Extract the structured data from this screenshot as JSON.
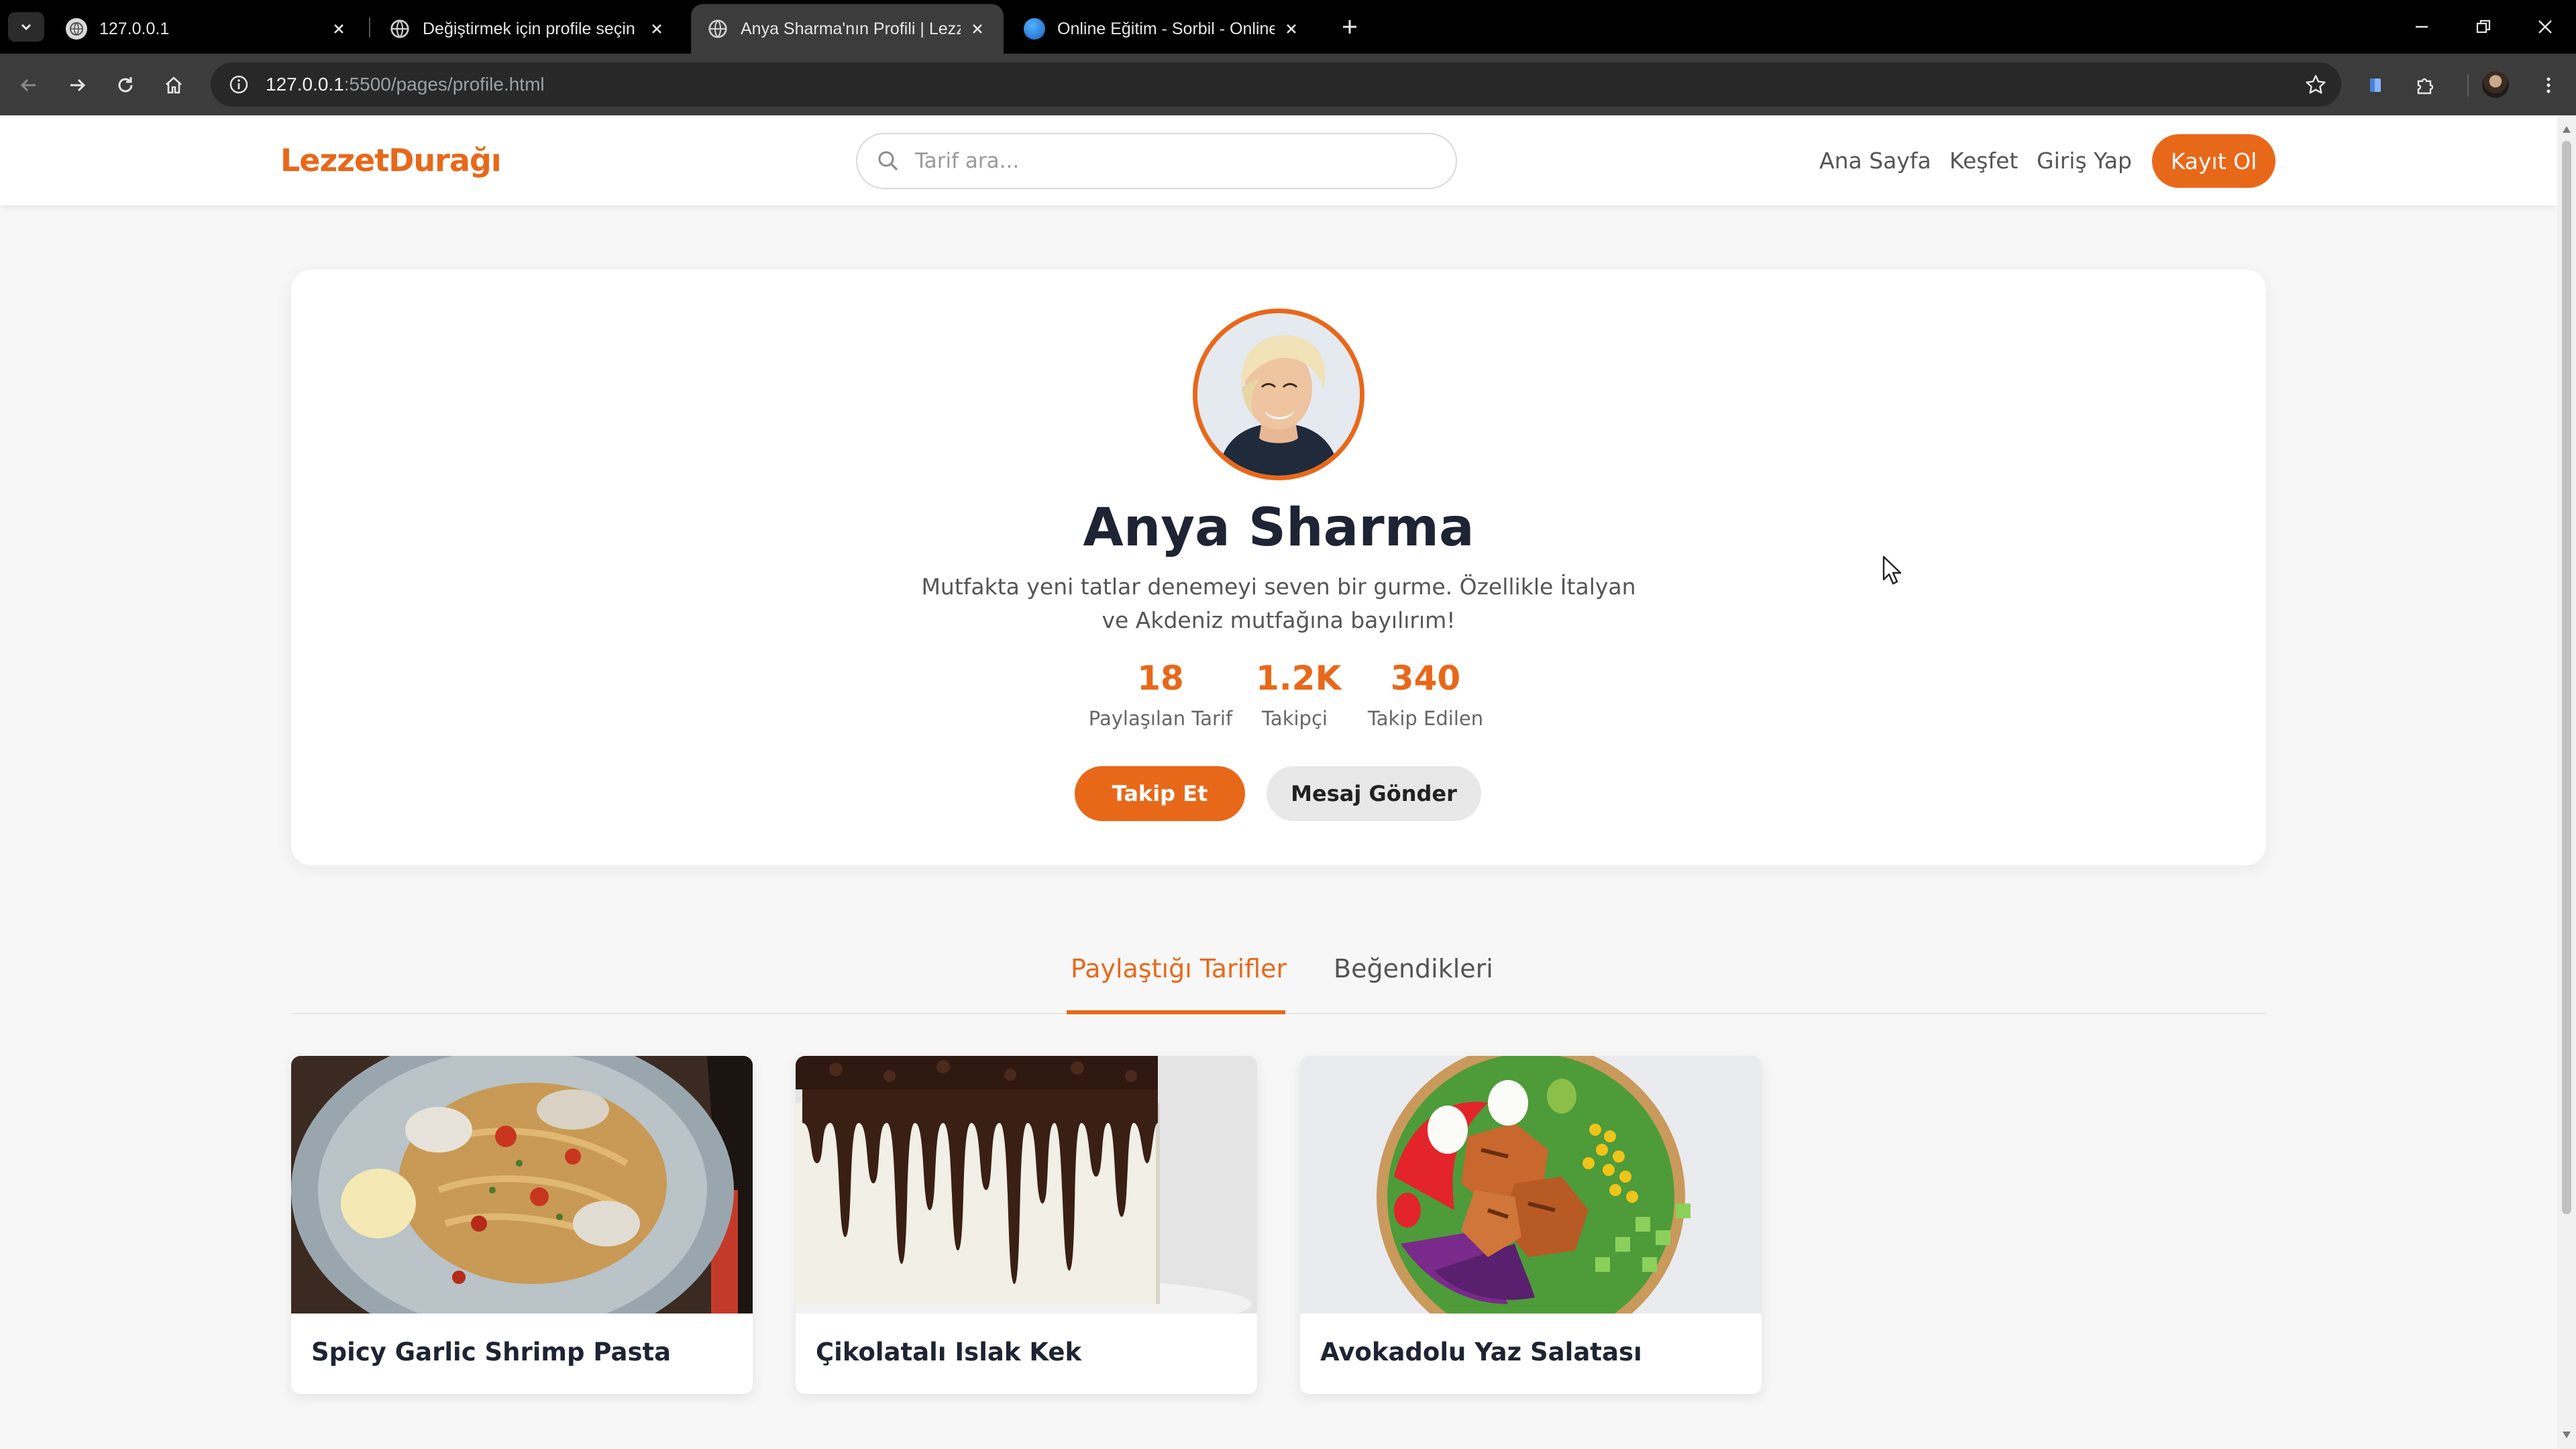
{
  "browser": {
    "tabs": [
      {
        "title": "127.0.0.1",
        "active": false
      },
      {
        "title": "Değiştirmek için profile seçin | L",
        "active": false
      },
      {
        "title": "Anya Sharma'nın Profili | Lezzet",
        "active": true
      },
      {
        "title": "Online Eğitim - Sorbil - Online E",
        "active": false
      }
    ],
    "url_host": "127.0.0.1",
    "url_path": ":5500/pages/profile.html"
  },
  "site": {
    "logo": "LezzetDurağı",
    "search_placeholder": "Tarif ara...",
    "nav": {
      "home": "Ana Sayfa",
      "explore": "Keşfet",
      "login": "Giriş Yap",
      "register": "Kayıt Ol"
    }
  },
  "profile": {
    "name": "Anya Sharma",
    "bio": "Mutfakta yeni tatlar denemeyi seven bir gurme. Özellikle İtalyan ve Akdeniz mutfağına bayılırım!",
    "stats": [
      {
        "value": "18",
        "label": "Paylaşılan Tarif"
      },
      {
        "value": "1.2K",
        "label": "Takipçi"
      },
      {
        "value": "340",
        "label": "Takip Edilen"
      }
    ],
    "follow_label": "Takip Et",
    "message_label": "Mesaj Gönder"
  },
  "content_tabs": [
    {
      "label": "Paylaştığı Tarifler",
      "active": true
    },
    {
      "label": "Beğendikleri",
      "active": false
    }
  ],
  "recipes": [
    {
      "title": "Spicy Garlic Shrimp Pasta",
      "image": "pasta-photo"
    },
    {
      "title": "Çikolatalı Islak Kek",
      "image": "chocolate-cake-photo"
    },
    {
      "title": "Avokadolu Yaz Salatası",
      "image": "salad-bowl-photo"
    }
  ],
  "colors": {
    "accent": "#e8681a",
    "heading": "#1e2433",
    "chrome_dark": "#000000",
    "chrome_toolbar": "#3c3c3c"
  }
}
